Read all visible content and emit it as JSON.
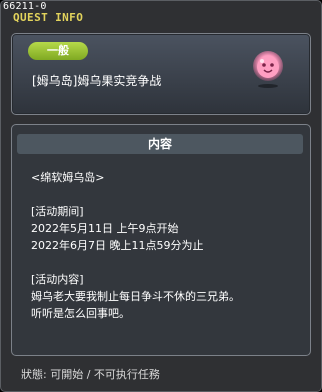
{
  "window": {
    "id_label": "66211-0",
    "title": "QUEST INFO"
  },
  "quest": {
    "category_badge": "一般",
    "title": "[姆乌岛]姆乌果实竞争战",
    "icon": "pink-blob-mascot-icon"
  },
  "content": {
    "header": "内容",
    "location": "<绵软姆乌岛>",
    "period_heading": "[活动期间]",
    "period_start": "2022年5月11日 上午9点开始",
    "period_end": "2022年6月7日 晚上11点59分为止",
    "details_heading": "[活动内容]",
    "details_line1": "姆乌老大要我制止每日争斗不休的三兄弟。",
    "details_line2": "听听是怎么回事吧。"
  },
  "status": {
    "text": "狀態: 可開始 / 不可执行任務"
  },
  "colors": {
    "badge_green": "#9bc436",
    "title_yellow": "#e2d35c",
    "panel_bg": "#33373d"
  }
}
